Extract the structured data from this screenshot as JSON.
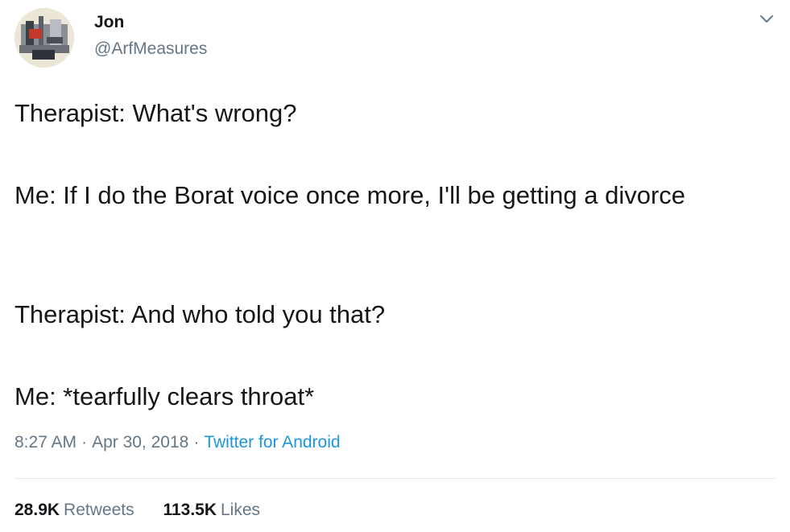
{
  "author": {
    "name": "Jon",
    "handle": "@ArfMeasures"
  },
  "icons": {
    "avatar": "avatar-image",
    "menu": "chevron-down-icon"
  },
  "tweet": {
    "paragraphs": [
      "Therapist: What's wrong?",
      "Me: If I do the Borat voice once more, I'll be getting a divorce",
      "Therapist: And who told you that?",
      "Me: *tearfully clears throat*"
    ]
  },
  "meta": {
    "time": "8:27 AM",
    "separator": "·",
    "date": "Apr 30, 2018",
    "source": "Twitter for Android"
  },
  "stats": {
    "retweets_count": "28.9K",
    "retweets_label": "Retweets",
    "likes_count": "113.5K",
    "likes_label": "Likes"
  },
  "colors": {
    "text": "#14171a",
    "secondary": "#657786",
    "link": "#1b95e0",
    "divider": "#e1e8ed"
  }
}
